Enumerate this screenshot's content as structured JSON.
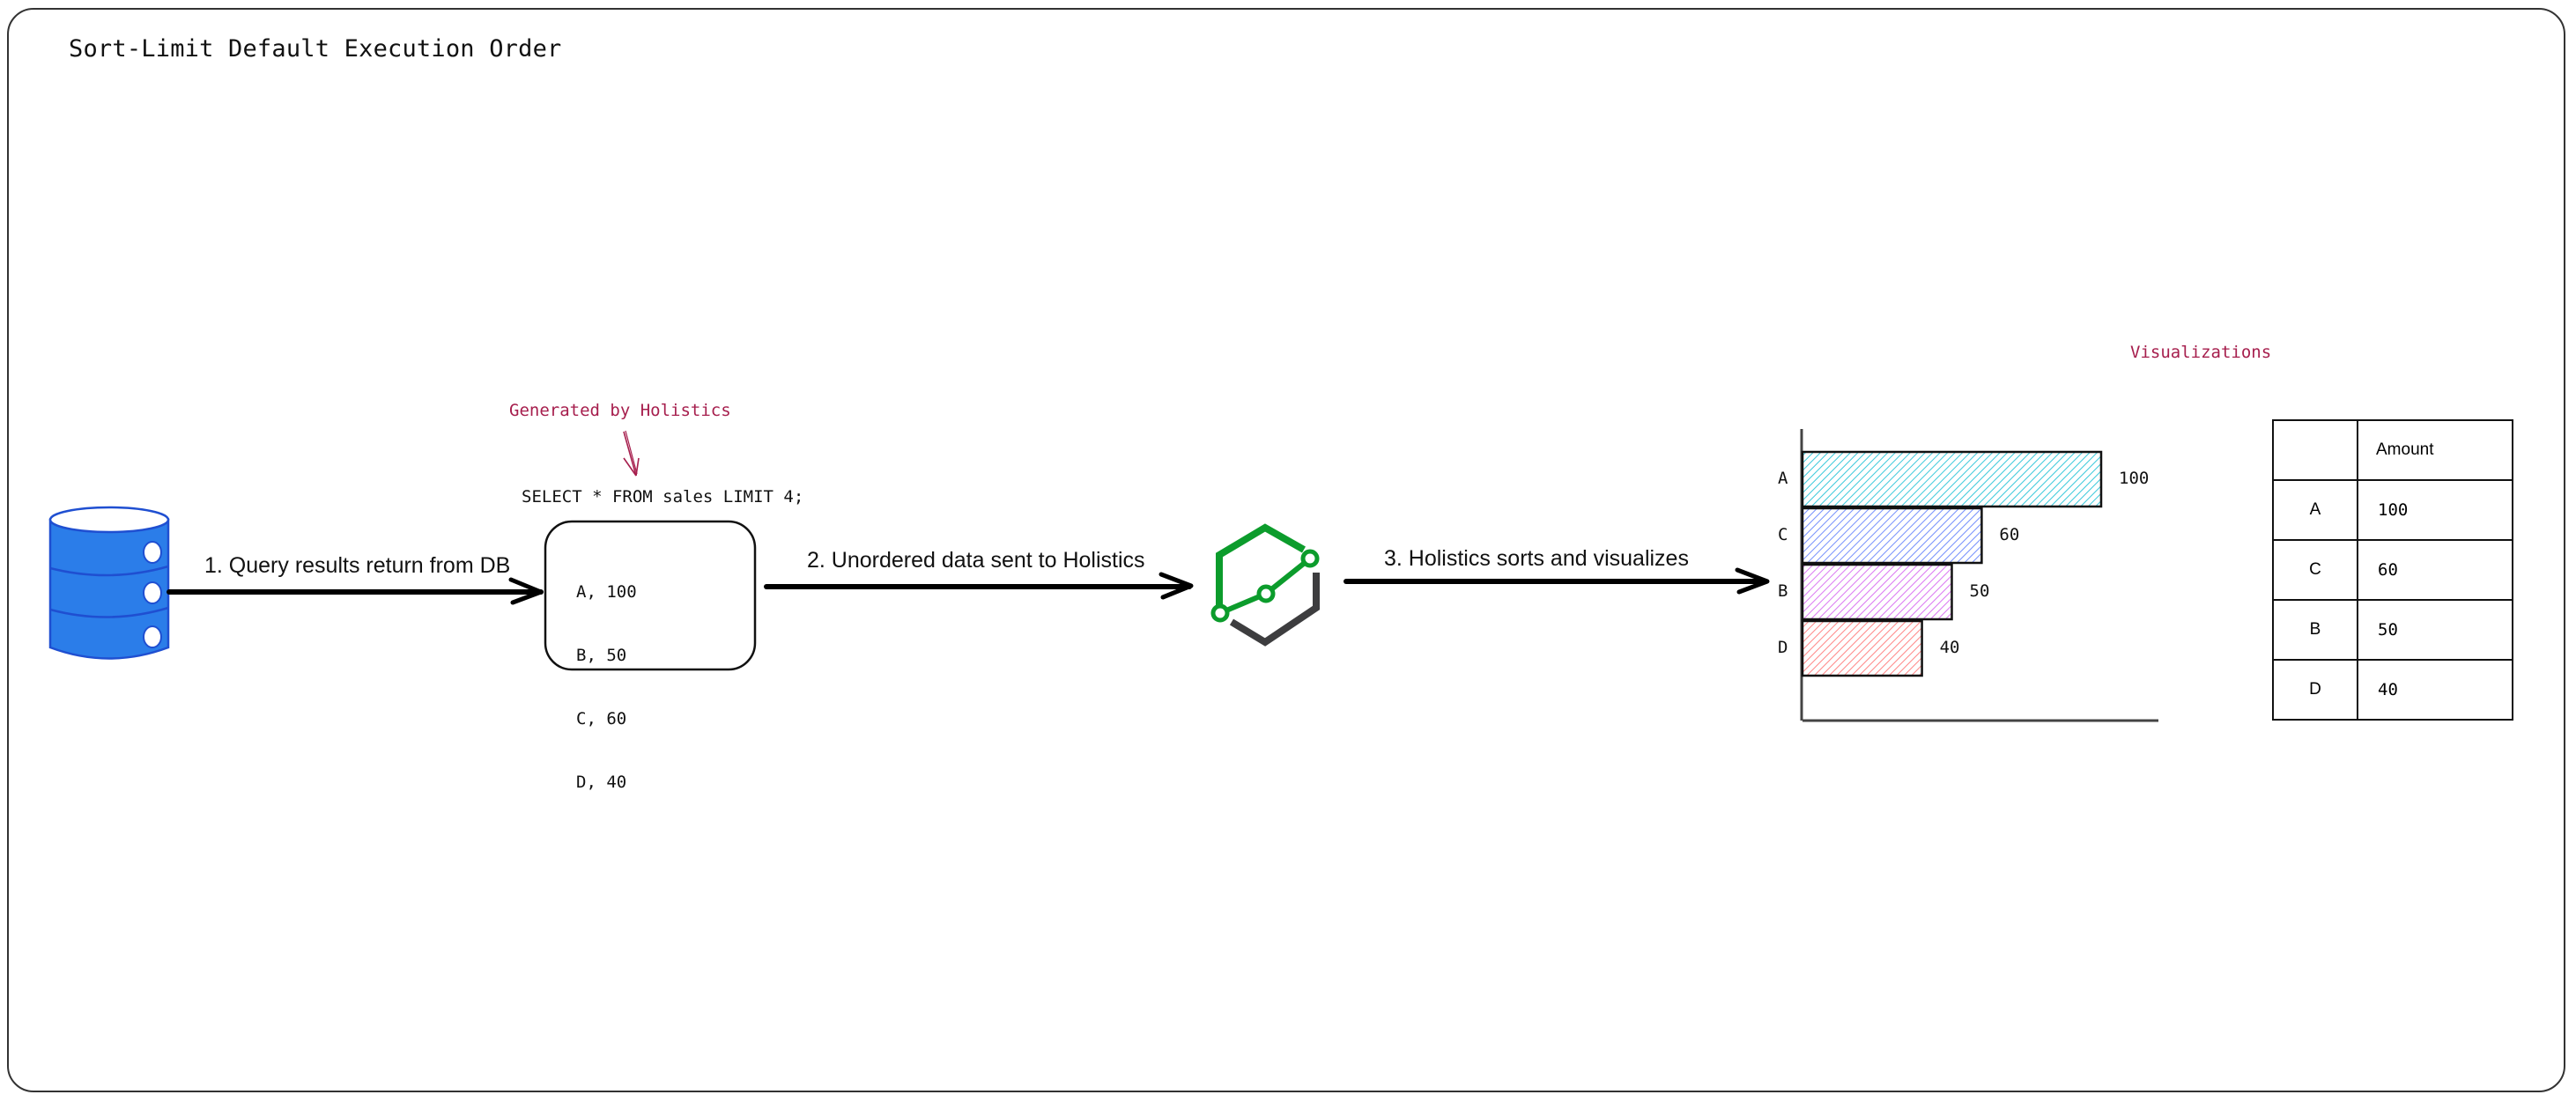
{
  "diagram": {
    "title": "Sort-Limit Default Execution Order",
    "annotation_generated": "Generated by Holistics",
    "sql_query": "SELECT * FROM sales LIMIT 4;",
    "query_rows": [
      "A, 100",
      "B, 50",
      "C, 60",
      "D, 40"
    ],
    "steps": [
      {
        "label": "1. Query results return from DB"
      },
      {
        "label": "2. Unordered data sent to Holistics"
      },
      {
        "label": "3. Holistics sorts and visualizes"
      }
    ],
    "annotation_visualizations": "Visualizations",
    "icons": {
      "database": "database-icon",
      "holistics_logo": "holistics-logo-icon"
    },
    "colors": {
      "annotation": "#a61e4d",
      "database_fill": "#2b7de9",
      "database_stroke": "#1f4fd1",
      "logo_green": "#0c9c2c",
      "logo_dark": "#3d3d3f"
    },
    "table": {
      "header": [
        "",
        "Amount"
      ],
      "rows": [
        [
          "A",
          "100"
        ],
        [
          "C",
          "60"
        ],
        [
          "B",
          "50"
        ],
        [
          "D",
          "40"
        ]
      ]
    }
  },
  "chart_data": {
    "type": "bar",
    "orientation": "horizontal",
    "title": "",
    "xlabel": "",
    "ylabel": "",
    "categories": [
      "A",
      "C",
      "B",
      "D"
    ],
    "values": [
      100,
      60,
      50,
      40
    ],
    "data_labels": [
      "100",
      "60",
      "50",
      "40"
    ],
    "bar_colors": [
      "#3bc9db",
      "#748ffc",
      "#da77f2",
      "#ff8787"
    ],
    "xlim": [
      0,
      100
    ],
    "grid": false,
    "legend": "none",
    "fill_style": "hachure"
  }
}
